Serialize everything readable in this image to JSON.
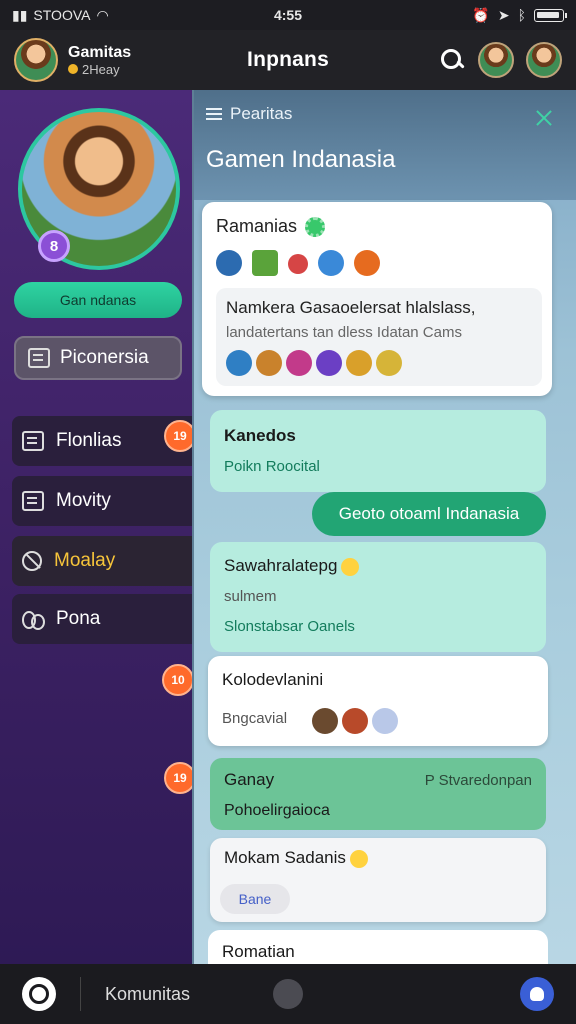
{
  "status_bar": {
    "carrier": "STOOVA",
    "time": "4:55"
  },
  "header": {
    "profile_name": "Gamitas",
    "profile_status": "2Heay",
    "title": "Inpnans"
  },
  "sidebar": {
    "hero_badge": "8",
    "hero_button": "Gan ndanas",
    "primary_tab": "Piconersia",
    "items": [
      {
        "label": "Flonlias",
        "badge": "19"
      },
      {
        "label": "Movity"
      },
      {
        "label": "Moalay"
      },
      {
        "label": "Pona"
      }
    ]
  },
  "panel": {
    "menu_label": "Pearitas",
    "title": "Gamen Indanasia",
    "main_card": {
      "title": "Ramanias",
      "inner_line1": "Namkera Gasaoelersat hlalslass,",
      "inner_line2": "landatertans tan dless Idatan Cams"
    },
    "messages": [
      {
        "title": "Kanedos",
        "sub": "Poikn Roocital",
        "badge": "19"
      },
      {
        "pill": "Geoto otoaml Indanasia"
      },
      {
        "title": "Sawahralatepg",
        "line2": "sulmem",
        "sub": "Slonstabsar Oanels"
      },
      {
        "title": "Kolodevlanini",
        "sub": "Bngcavial",
        "badge": "10"
      },
      {
        "title": "Ganay",
        "right": "P Stvaredonpan",
        "sub": "Pohoelirgaioca",
        "badge": "19"
      },
      {
        "title": "Mokam Sadanis",
        "chip": "Bane"
      },
      {
        "title": "Romatian"
      }
    ]
  },
  "bottom_nav": {
    "label": "Komunitas"
  }
}
